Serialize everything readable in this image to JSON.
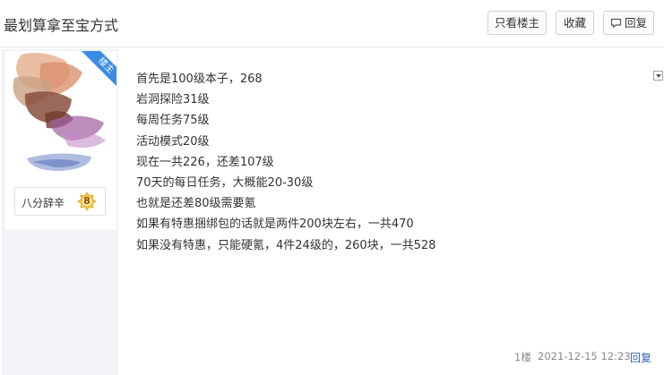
{
  "header": {
    "title": "最划算拿至宝方式",
    "buttons": {
      "only_op": "只看楼主",
      "favorite": "收藏",
      "reply": "回复"
    }
  },
  "author": {
    "badge": "楼主",
    "username": "八分辞辛",
    "level": "8"
  },
  "post": {
    "lines": [
      "首先是100级本子，268",
      "岩洞探险31级",
      "每周任务75级",
      "活动模式20级",
      "现在一共226，还差107级",
      "70天的每日任务，大概能20-30级",
      "也就是还差80级需要氪",
      "如果有特惠捆绑包的话就是两件200块左右，一共470",
      "如果没有特惠，只能硬氪，4件24级的，260块，一共528"
    ],
    "floor": "1楼",
    "time": "2021-12-15 12:23",
    "reply_label": "回复"
  },
  "colors": {
    "accent_blue": "#3b8ce4",
    "link_blue": "#2d64b3",
    "sidebar_bg": "#f1f3f7"
  },
  "icons": {
    "reply": "reply-icon",
    "dropdown": "chevron-down-icon",
    "level": "level-badge-icon"
  }
}
